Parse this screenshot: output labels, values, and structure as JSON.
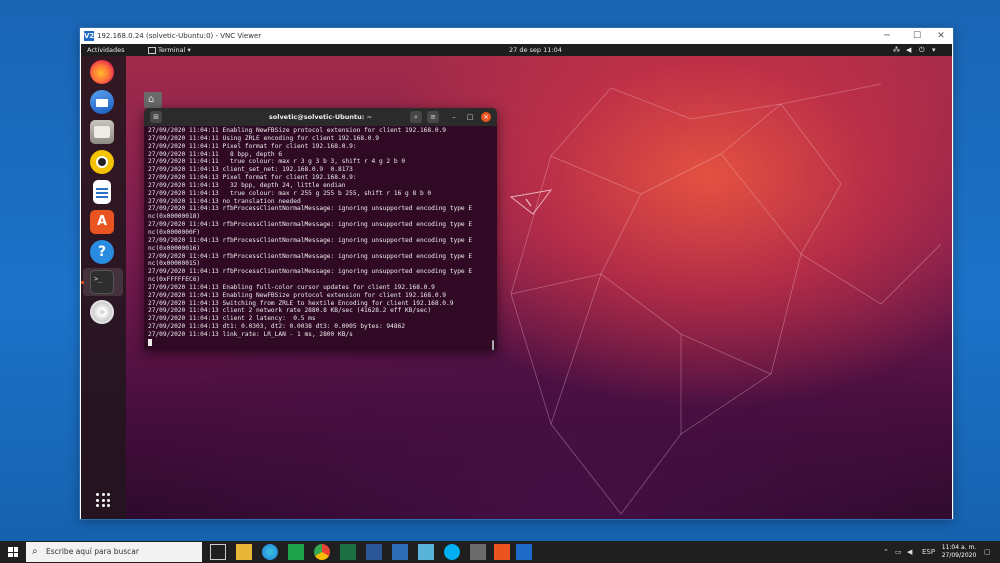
{
  "vnc_window": {
    "title": "192.168.0.24 (solvetic-Ubuntu:0) - VNC Viewer",
    "logo_text": "V2"
  },
  "ubuntu": {
    "activities": "Actividades",
    "app_menu": "Terminal ▾",
    "datetime": "27 de sep  11:04",
    "dock_apps": [
      "firefox-icon",
      "thunderbird-icon",
      "files-icon",
      "rhythmbox-icon",
      "libreoffice-writer-icon",
      "ubuntu-software-icon",
      "help-icon",
      "terminal-icon",
      "dvd-icon"
    ]
  },
  "terminal": {
    "title": "solvetic@solvetic-Ubuntu: ~",
    "lines": [
      "27/09/2020 11:04:11 Enabling NewFBSize protocol extension for client 192.168.0.9",
      "27/09/2020 11:04:11 Using ZRLE encoding for client 192.168.0.9",
      "27/09/2020 11:04:11 Pixel format for client 192.168.0.9:",
      "27/09/2020 11:04:11   8 bpp, depth 6",
      "27/09/2020 11:04:11   true colour: max r 3 g 3 b 3, shift r 4 g 2 b 0",
      "27/09/2020 11:04:13 client_set_net: 192.168.0.9  0.8173",
      "27/09/2020 11:04:13 Pixel format for client 192.168.0.9:",
      "27/09/2020 11:04:13   32 bpp, depth 24, little endian",
      "27/09/2020 11:04:13   true colour: max r 255 g 255 b 255, shift r 16 g 8 b 0",
      "27/09/2020 11:04:13 no translation needed",
      "27/09/2020 11:04:13 rfbProcessClientNormalMessage: ignoring unsupported encoding type E",
      "nc(0x00000018)",
      "27/09/2020 11:04:13 rfbProcessClientNormalMessage: ignoring unsupported encoding type E",
      "nc(0x0000000F)",
      "27/09/2020 11:04:13 rfbProcessClientNormalMessage: ignoring unsupported encoding type E",
      "nc(0x00000016)",
      "27/09/2020 11:04:13 rfbProcessClientNormalMessage: ignoring unsupported encoding type E",
      "nc(0x00000015)",
      "27/09/2020 11:04:13 rfbProcessClientNormalMessage: ignoring unsupported encoding type E",
      "nc(0xFFFFFEC6)",
      "27/09/2020 11:04:13 Enabling full-color cursor updates for client 192.168.0.9",
      "27/09/2020 11:04:13 Enabling NewFBSize protocol extension for client 192.168.0.9",
      "27/09/2020 11:04:13 Switching from ZRLE to hextile Encoding for client 192.168.0.9",
      "27/09/2020 11:04:13 client 2 network rate 2880.8 KB/sec (41628.2 eff KB/sec)",
      "27/09/2020 11:04:13 client 2 latency:  0.5 ms",
      "27/09/2020 11:04:13 dt1: 0.0303, dt2: 0.0038 dt3: 0.0005 bytes: 94862",
      "27/09/2020 11:04:13 link_rate: LR_LAN - 1 ms, 2800 KB/s"
    ]
  },
  "taskbar": {
    "search_placeholder": "Escribe aquí para buscar",
    "language": "ESP",
    "time": "11:04 a. m.",
    "date": "27/09/2020"
  },
  "colors": {
    "terminal_bg": "#300a24",
    "windows_blue": "#1b6fc0",
    "ubuntu_orange": "#e95420"
  }
}
